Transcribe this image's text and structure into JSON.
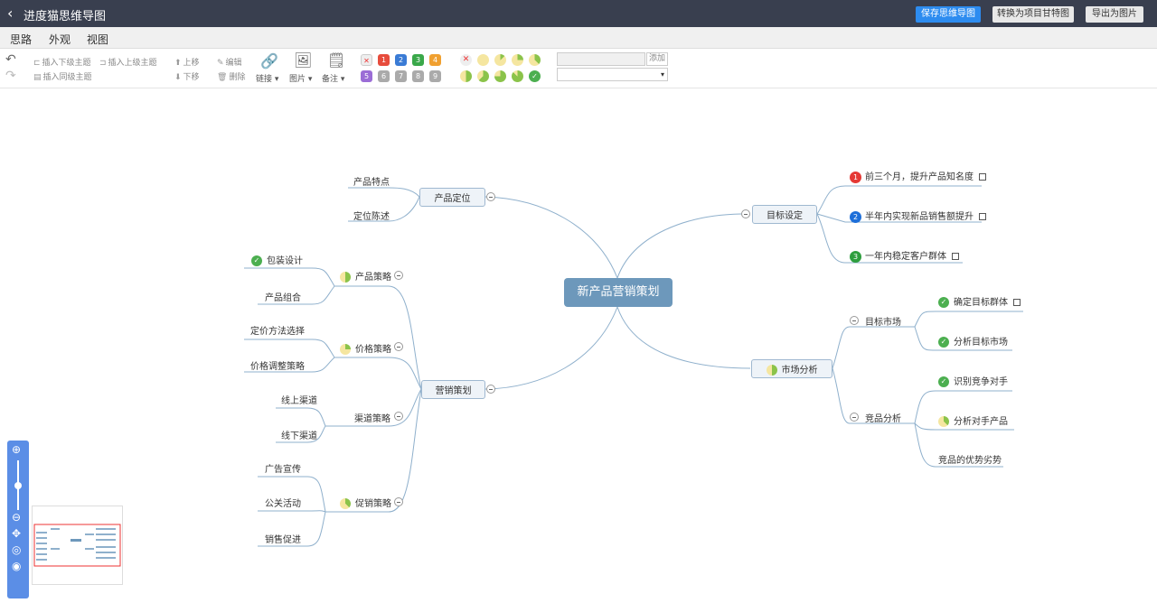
{
  "titlebar": {
    "title": "进度猫思维导图",
    "save_label": "保存思维导图",
    "convert_label": "转换为项目甘特图",
    "export_label": "导出为图片"
  },
  "tabs": [
    "思路",
    "外观",
    "视图"
  ],
  "toolbar": {
    "insert_child": "插入下级主题",
    "insert_parent": "插入上级主题",
    "insert_sibling": "插入同级主题",
    "move_up": "上移",
    "move_down": "下移",
    "edit": "编辑",
    "delete": "删除",
    "link": "链接",
    "image": "图片",
    "note": "备注",
    "priorities": [
      "1",
      "2",
      "3",
      "4",
      "5",
      "6",
      "7",
      "8",
      "9"
    ],
    "add_label": "添加"
  },
  "mindmap": {
    "root": "新产品营销策划",
    "goal": {
      "label": "目标设定",
      "items": [
        "前三个月，提升产品知名度",
        "半年内实现新品销售额提升",
        "一年内稳定客户群体"
      ]
    },
    "market": {
      "label": "市场分析",
      "target": {
        "label": "目标市场",
        "items": [
          "确定目标群体",
          "分析目标市场"
        ]
      },
      "competitor": {
        "label": "竞品分析",
        "items": [
          "识别竞争对手",
          "分析对手产品",
          "竞品的优势劣势"
        ]
      }
    },
    "positioning": {
      "label": "产品定位",
      "items": [
        "产品特点",
        "定位陈述"
      ]
    },
    "marketing": {
      "label": "营销策划",
      "product": {
        "label": "产品策略",
        "items": [
          "包装设计",
          "产品组合"
        ]
      },
      "price": {
        "label": "价格策略",
        "items": [
          "定价方法选择",
          "价格调整策略"
        ]
      },
      "channel": {
        "label": "渠道策略",
        "items": [
          "线上渠道",
          "线下渠道"
        ]
      },
      "promo": {
        "label": "促销策略",
        "items": [
          "广告宣传",
          "公关活动",
          "销售促进"
        ]
      }
    }
  },
  "colors": {
    "titlebar": "#393f4f",
    "accent": "#2d8cf0",
    "root": "#6d98bb",
    "link": "#8fb0cc",
    "zoombar": "#5b8ee6"
  }
}
